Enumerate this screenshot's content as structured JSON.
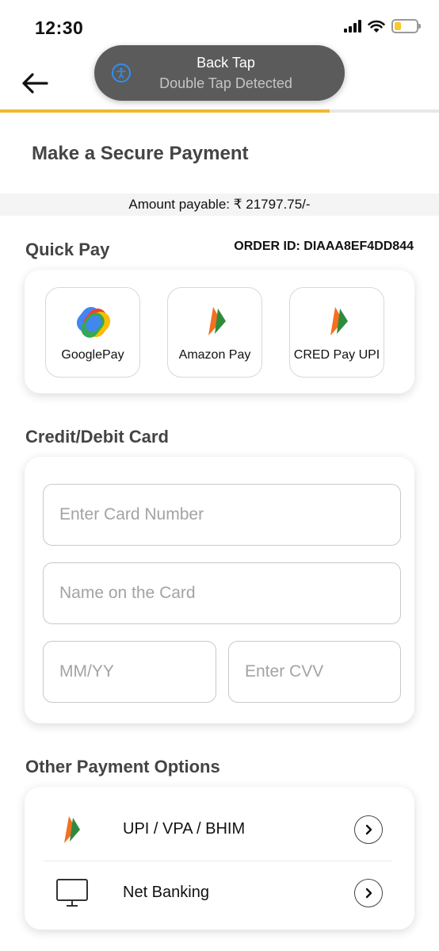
{
  "status": {
    "time": "12:30"
  },
  "toast": {
    "title": "Back Tap",
    "subtitle": "Double Tap Detected"
  },
  "header": {
    "page_title": "Make a Secure Payment",
    "progress": 0.75
  },
  "amount": {
    "text": "Amount payable: ₹ 21797.75/-"
  },
  "quick_pay": {
    "title": "Quick Pay",
    "order_id": "ORDER ID: DIAAA8EF4DD844",
    "options": [
      {
        "label": "GooglePay",
        "icon": "google-pay-icon"
      },
      {
        "label": "Amazon Pay",
        "icon": "upi-icon"
      },
      {
        "label": "CRED Pay UPI",
        "icon": "upi-icon"
      }
    ]
  },
  "card": {
    "title": "Credit/Debit Card",
    "card_number_placeholder": "Enter Card Number",
    "name_placeholder": "Name on the Card",
    "expiry_placeholder": "MM/YY",
    "cvv_placeholder": "Enter CVV"
  },
  "other": {
    "title": "Other Payment Options",
    "options": [
      {
        "label": "UPI / VPA / BHIM",
        "icon": "upi-icon"
      },
      {
        "label": "Net Banking",
        "icon": "monitor-icon"
      }
    ]
  },
  "colors": {
    "accent": "#f2b731",
    "toast_bg": "#5b5b5b",
    "accessibility_blue": "#2f8ff3"
  }
}
